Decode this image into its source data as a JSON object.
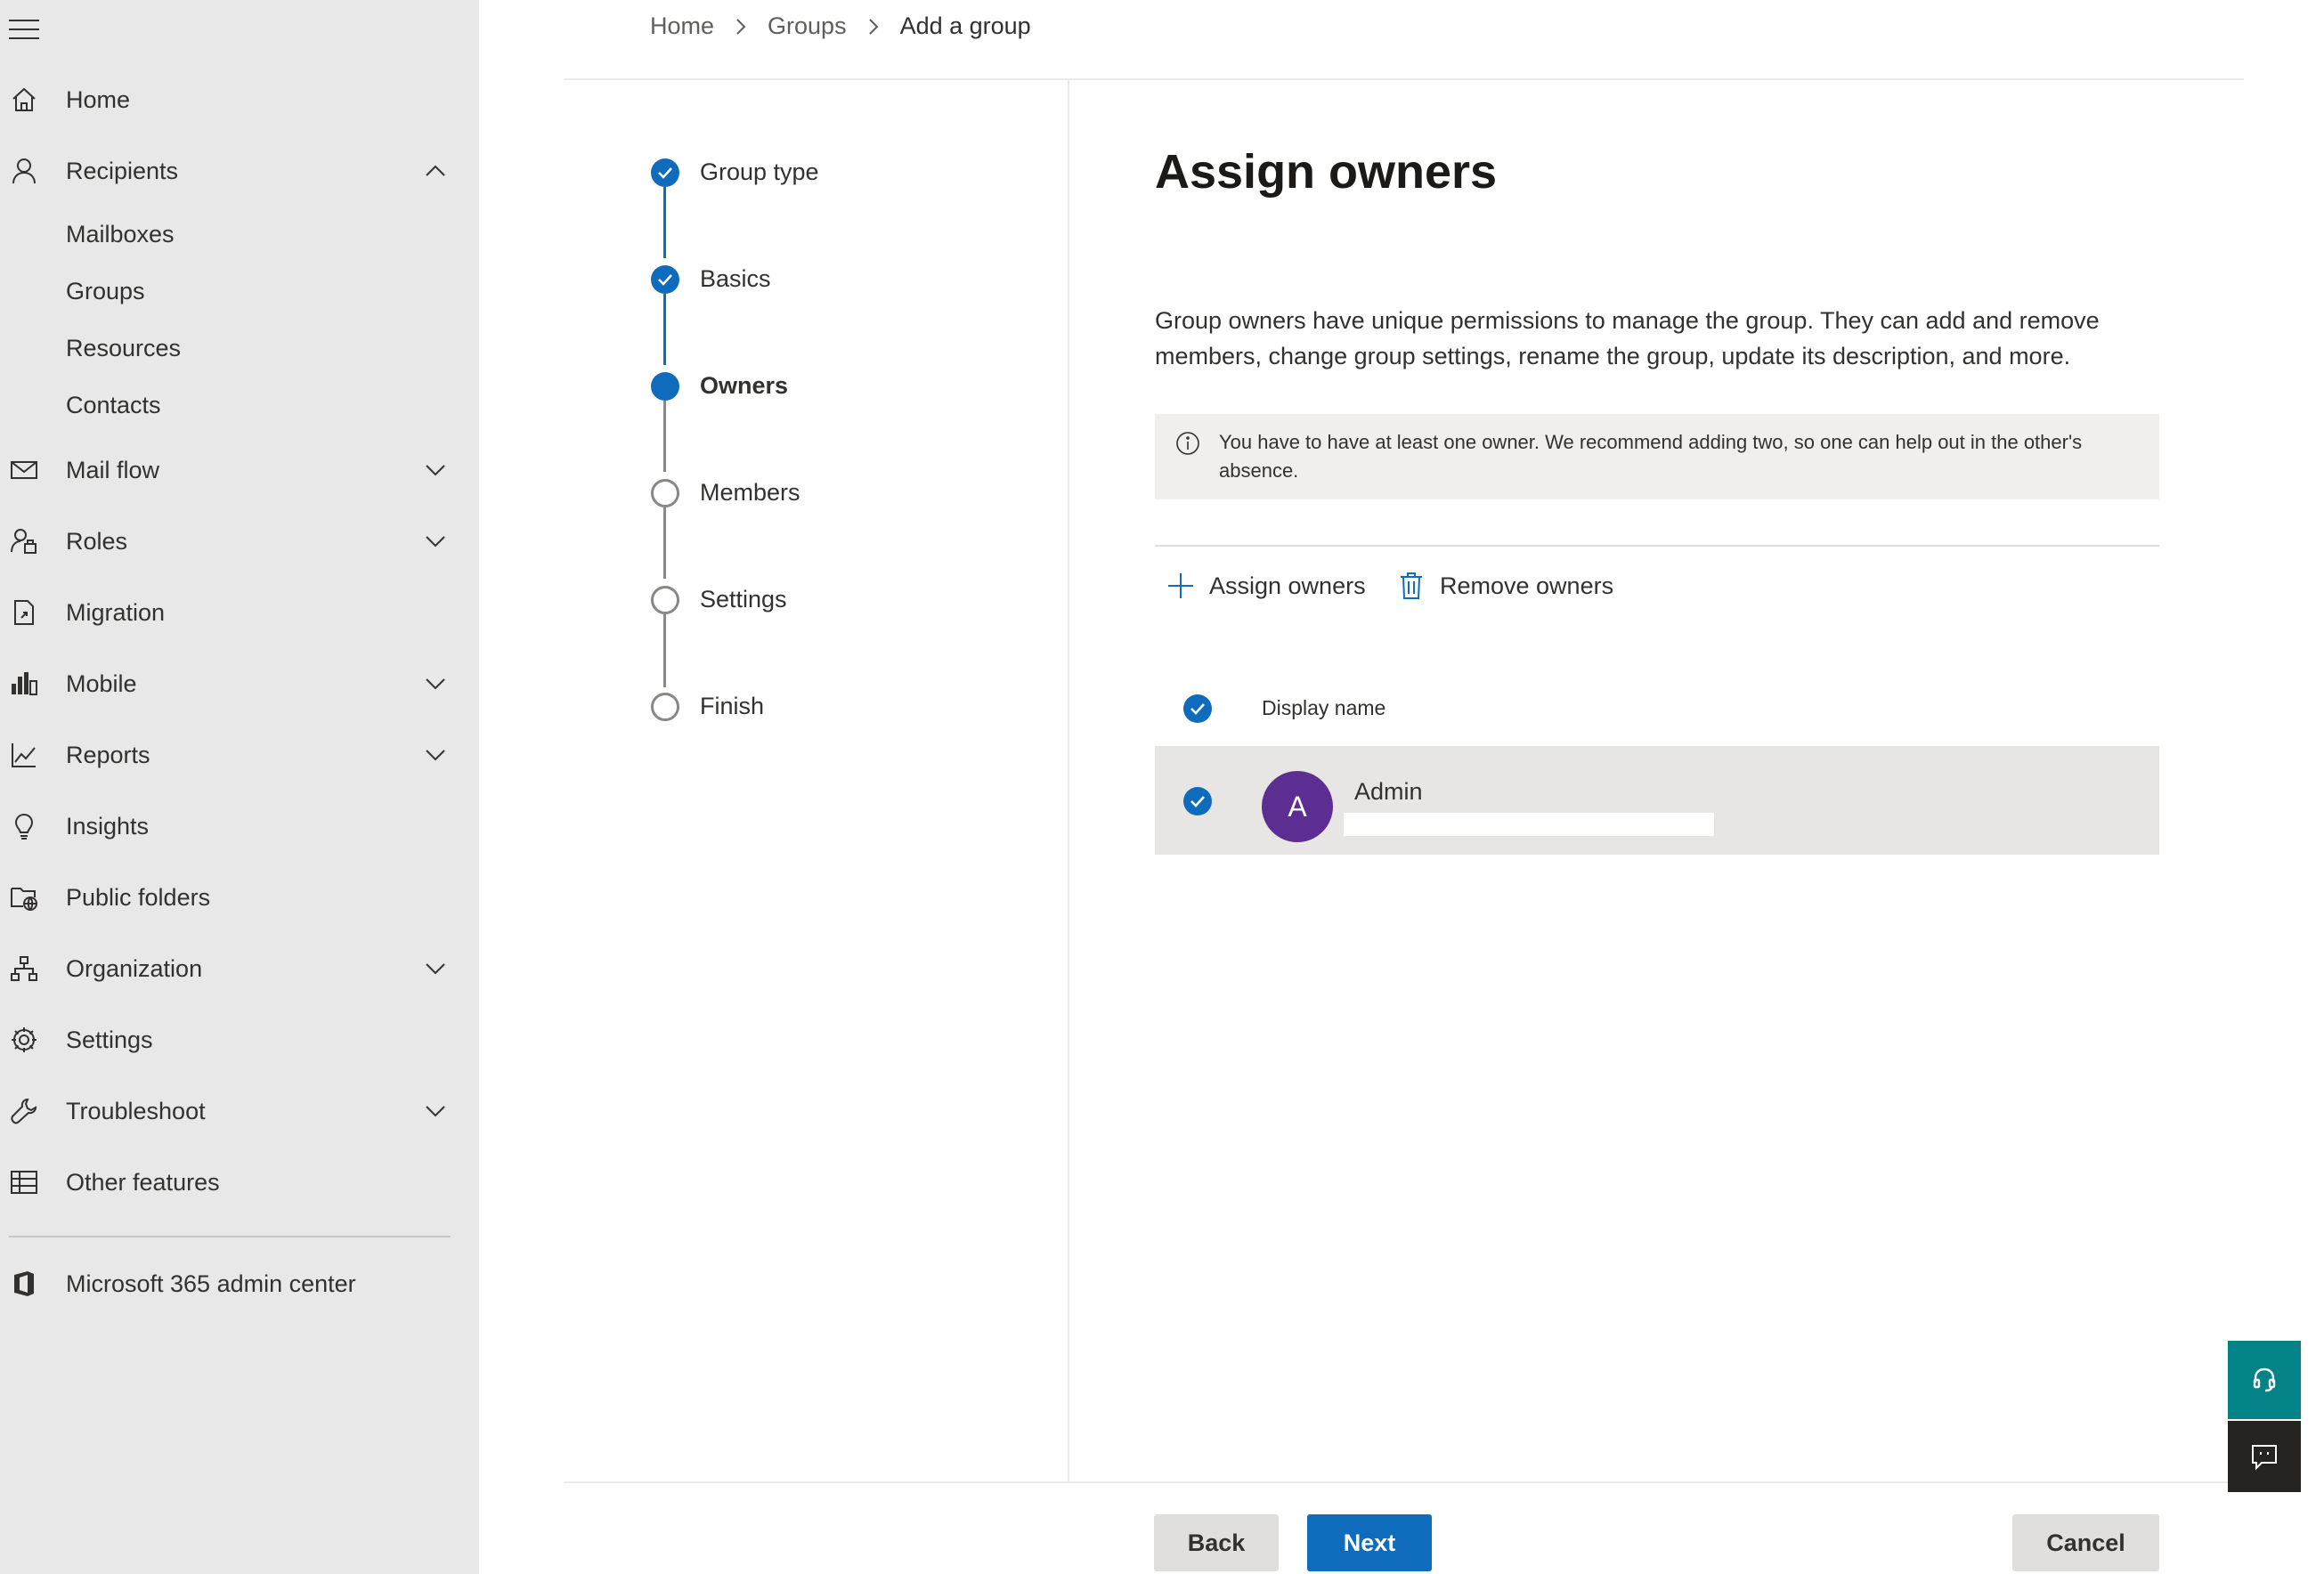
{
  "sidebar": {
    "items": [
      {
        "label": "Home",
        "icon": "home-icon"
      },
      {
        "label": "Recipients",
        "icon": "person-icon",
        "expanded": true,
        "children": [
          "Mailboxes",
          "Groups",
          "Resources",
          "Contacts"
        ]
      },
      {
        "label": "Mail flow",
        "icon": "mail-icon",
        "expandable": true
      },
      {
        "label": "Roles",
        "icon": "roles-icon",
        "expandable": true
      },
      {
        "label": "Migration",
        "icon": "migration-icon"
      },
      {
        "label": "Mobile",
        "icon": "mobile-icon",
        "expandable": true
      },
      {
        "label": "Reports",
        "icon": "reports-icon",
        "expandable": true
      },
      {
        "label": "Insights",
        "icon": "lightbulb-icon"
      },
      {
        "label": "Public folders",
        "icon": "public-folders-icon"
      },
      {
        "label": "Organization",
        "icon": "organization-icon",
        "expandable": true
      },
      {
        "label": "Settings",
        "icon": "gear-icon"
      },
      {
        "label": "Troubleshoot",
        "icon": "wrench-icon",
        "expandable": true
      },
      {
        "label": "Other features",
        "icon": "grid-icon"
      }
    ],
    "admin_center": "Microsoft 365 admin center"
  },
  "breadcrumb": [
    "Home",
    "Groups",
    "Add a group"
  ],
  "steps": [
    {
      "label": "Group type",
      "state": "done"
    },
    {
      "label": "Basics",
      "state": "done"
    },
    {
      "label": "Owners",
      "state": "current"
    },
    {
      "label": "Members",
      "state": "todo"
    },
    {
      "label": "Settings",
      "state": "todo"
    },
    {
      "label": "Finish",
      "state": "todo"
    }
  ],
  "main": {
    "title": "Assign owners",
    "description": "Group owners have unique permissions to manage the group. They can add and remove members, change group settings, rename the group, update its description, and more.",
    "info": "You have to have at least one owner. We recommend adding two, so one can help out in the other's absence.",
    "commands": {
      "assign": "Assign owners",
      "remove": "Remove owners"
    },
    "table": {
      "header": "Display name",
      "rows": [
        {
          "initial": "A",
          "name": "Admin",
          "selected": true
        }
      ]
    }
  },
  "footer": {
    "back": "Back",
    "next": "Next",
    "cancel": "Cancel"
  },
  "colors": {
    "accent": "#0f6cbd",
    "avatar": "#5c2e91",
    "help": "#038387"
  }
}
